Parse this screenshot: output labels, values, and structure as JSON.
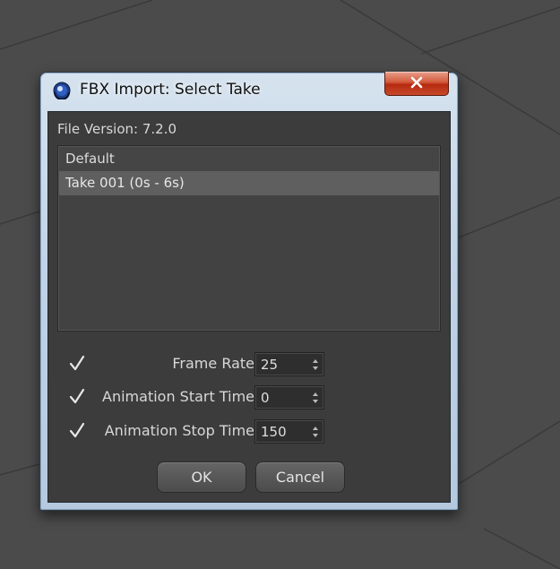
{
  "window": {
    "title": "FBX Import: Select Take"
  },
  "file_version": {
    "label": "File Version:",
    "value": "7.2.0"
  },
  "takes": [
    {
      "label": "Default",
      "selected": false
    },
    {
      "label": "Take 001  (0s - 6s)",
      "selected": true
    }
  ],
  "options": [
    {
      "label": "Frame Rate",
      "checked": true,
      "value": "25"
    },
    {
      "label": "Animation Start Time",
      "checked": true,
      "value": "0"
    },
    {
      "label": "Animation Stop Time",
      "checked": true,
      "value": "150"
    }
  ],
  "buttons": {
    "ok": "OK",
    "cancel": "Cancel"
  },
  "icons": {
    "app": "cinema4d-sphere-icon",
    "close": "close-icon",
    "check": "checkmark-icon",
    "spinner": "spinner-arrows-icon"
  },
  "colors": {
    "panel": "#3c3c3c",
    "selection": "#5f5f5f",
    "text": "#d8d8d8",
    "close_button": "#c74a2a"
  }
}
